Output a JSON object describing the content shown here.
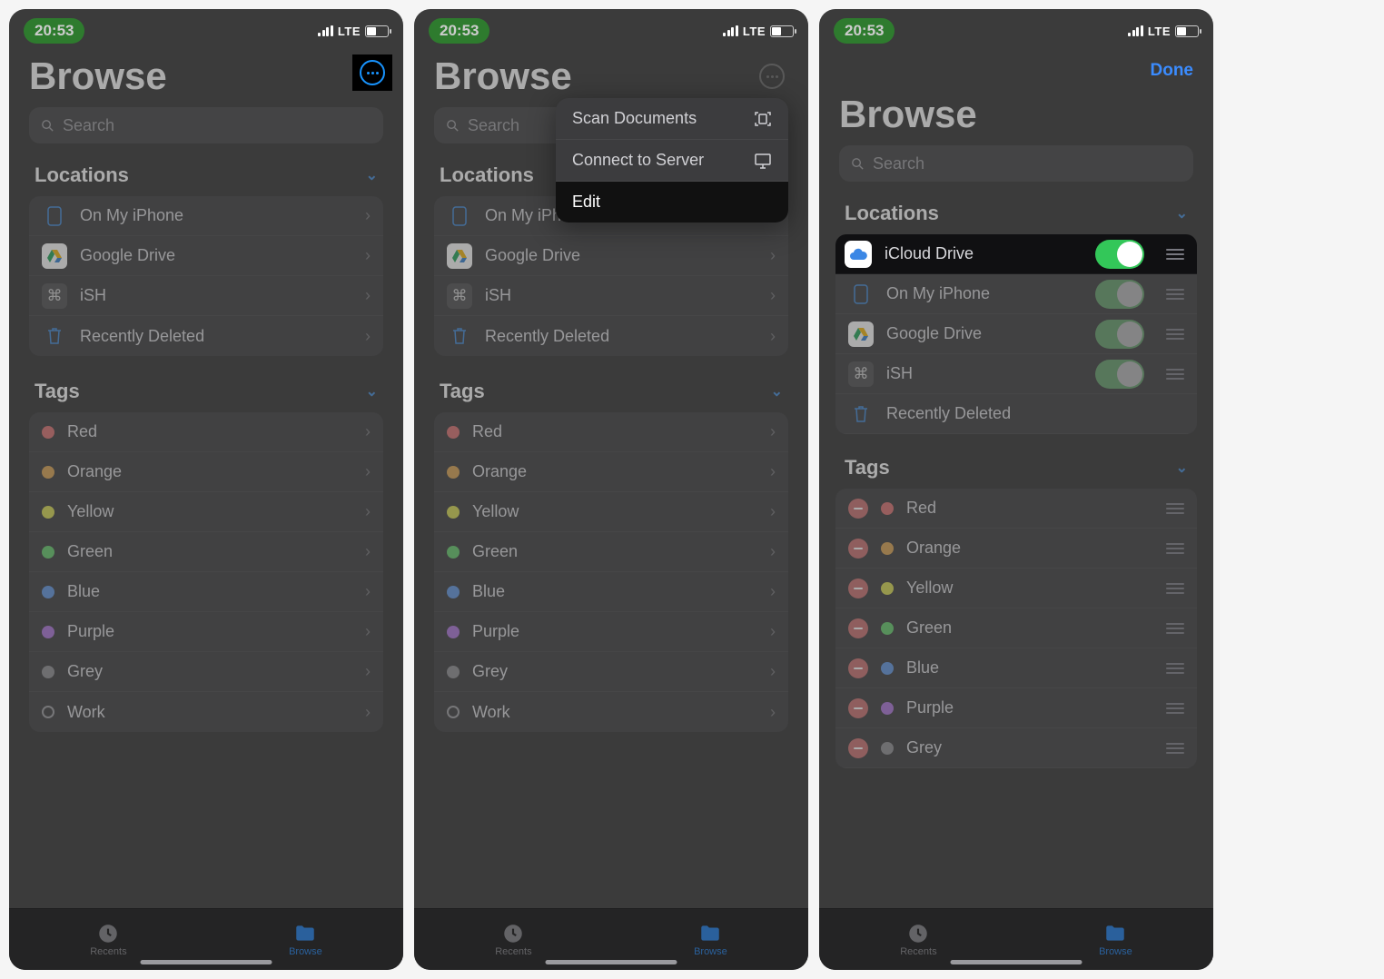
{
  "status": {
    "time": "20:53",
    "network": "LTE"
  },
  "title": "Browse",
  "search_placeholder": "Search",
  "done_label": "Done",
  "sections": {
    "locations": "Locations",
    "tags": "Tags"
  },
  "locations": {
    "on_my_iphone": "On My iPhone",
    "google_drive": "Google Drive",
    "ish": "iSH",
    "recently_deleted": "Recently Deleted",
    "icloud_drive": "iCloud Drive"
  },
  "tags": {
    "red": "Red",
    "orange": "Orange",
    "yellow": "Yellow",
    "green": "Green",
    "blue": "Blue",
    "purple": "Purple",
    "grey": "Grey",
    "work": "Work"
  },
  "menu": {
    "scan": "Scan Documents",
    "connect": "Connect to Server",
    "edit": "Edit"
  },
  "tabs": {
    "recents": "Recents",
    "browse": "Browse"
  }
}
